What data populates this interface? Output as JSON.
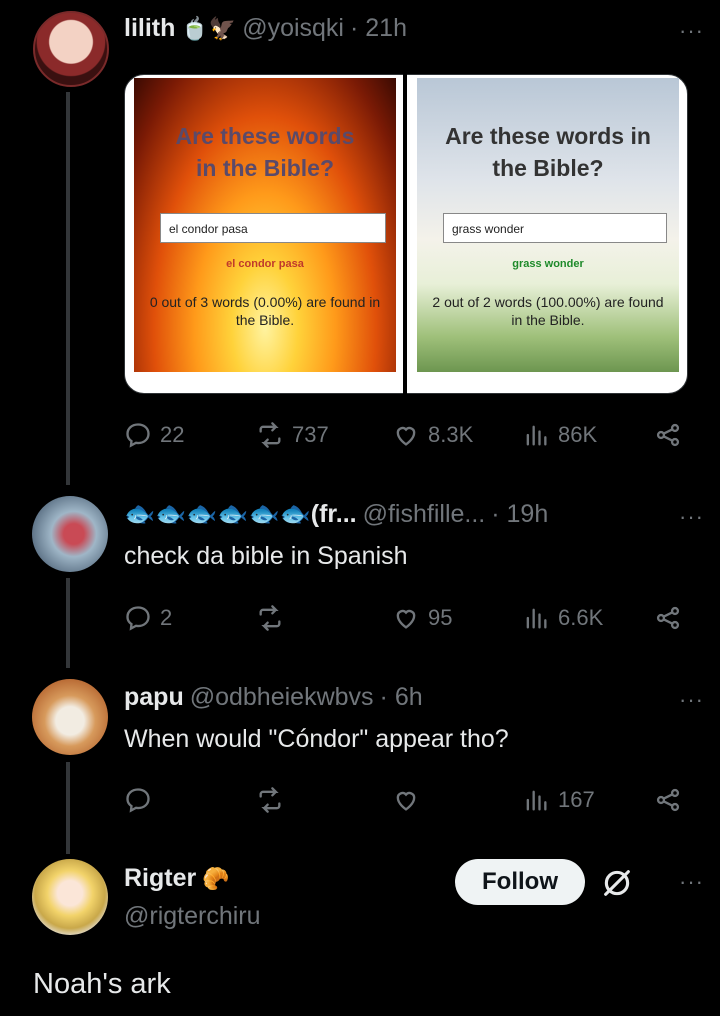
{
  "tweet1": {
    "name": "lilith",
    "emoji": "🍵🦅",
    "handle": "@yoisqki",
    "time": "· 21h",
    "more": "···",
    "left_panel": {
      "title": "Are these words in the Bible?",
      "input": "el condor pasa",
      "echo": "el condor pasa",
      "result": "0 out of 3 words (0.00%) are found in the Bible."
    },
    "right_panel": {
      "title": "Are these words in the Bible?",
      "input": "grass wonder",
      "echo": "grass wonder",
      "result": "2 out of 2 words (100.00%) are found in the Bible."
    },
    "replies": "22",
    "reposts": "737",
    "likes": "8.3K",
    "views": "86K"
  },
  "tweet2": {
    "name": "🐟🐟🐟🐟🐟🐟(fr...",
    "handle": "@fishfille...",
    "time": "· 19h",
    "more": "···",
    "text": "check da bible in Spanish",
    "replies": "2",
    "likes": "95",
    "views": "6.6K"
  },
  "tweet3": {
    "name": "papu",
    "handle": "@odbheiekwbvs",
    "time": "· 6h",
    "more": "···",
    "text": "When would \"Cóndor\" appear tho?",
    "views": "167"
  },
  "tweet4": {
    "name": "Rigter",
    "emoji": "🥐",
    "handle": "@rigterchiru",
    "follow_label": "Follow",
    "more": "···",
    "text": "Noah's ark"
  },
  "colors": {
    "background": "#000000",
    "text_primary": "#e7e9ea",
    "text_secondary": "#71767b",
    "echo_red": "#c0392b",
    "echo_green": "#1e8a2a"
  },
  "icons": [
    "reply-icon",
    "repost-icon",
    "like-icon",
    "views-icon",
    "share-icon",
    "grok-icon",
    "more-icon"
  ]
}
